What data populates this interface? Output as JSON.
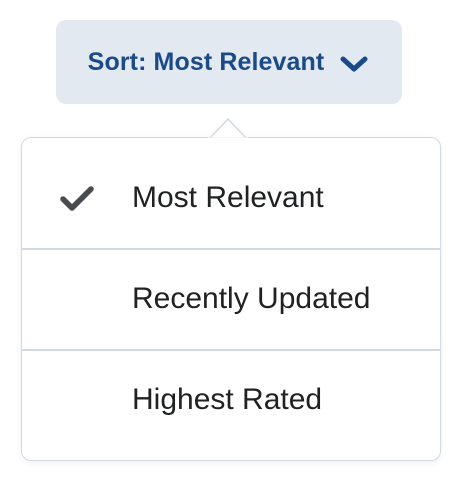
{
  "sort_button": {
    "prefix": "Sort: ",
    "value": "Most Relevant",
    "label": "Sort: Most Relevant"
  },
  "menu": {
    "items": [
      {
        "label": "Most Relevant",
        "selected": true
      },
      {
        "label": "Recently Updated",
        "selected": false
      },
      {
        "label": "Highest Rated",
        "selected": false
      }
    ]
  },
  "icons": {
    "dropdown": "chevron-down-icon",
    "selected": "checkmark-icon"
  },
  "colors": {
    "button_bg": "#e3e9f1",
    "button_text": "#1a4a87",
    "menu_border": "#d3d9e3",
    "item_text": "#202122",
    "check": "#494c4f"
  }
}
